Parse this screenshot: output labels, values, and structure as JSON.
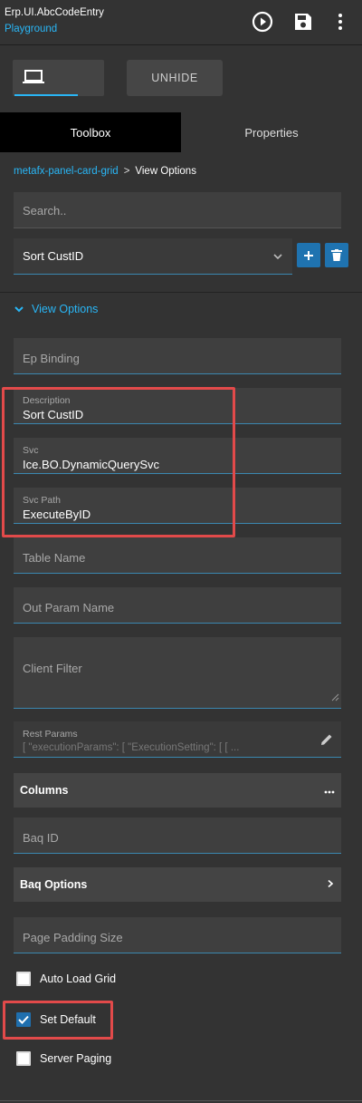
{
  "header": {
    "title": "Erp.UI.AbcCodeEntry",
    "subtitle": "Playground",
    "icons": [
      "play-icon",
      "save-icon",
      "more-vertical-icon"
    ]
  },
  "device": {
    "icon": "laptop-icon",
    "unhide_label": "UNHIDE"
  },
  "tabs": [
    {
      "label": "Toolbox",
      "active": true
    },
    {
      "label": "Properties",
      "active": false
    }
  ],
  "breadcrumb": {
    "link": "metafx-panel-card-grid",
    "separator": ">",
    "current": "View Options"
  },
  "search": {
    "placeholder": "Search.."
  },
  "sort_select": {
    "value": "Sort CustID"
  },
  "section": {
    "label": "View Options"
  },
  "fields": {
    "ep_binding": {
      "placeholder": "Ep Binding"
    },
    "description": {
      "label": "Description",
      "value": "Sort CustID"
    },
    "svc": {
      "label": "Svc",
      "value": "Ice.BO.DynamicQuerySvc"
    },
    "svc_path": {
      "label": "Svc Path",
      "value": "ExecuteByID"
    },
    "table_name": {
      "placeholder": "Table Name"
    },
    "out_param_name": {
      "placeholder": "Out Param Name"
    },
    "client_filter": {
      "placeholder": "Client Filter"
    },
    "rest_params": {
      "label": "Rest Params",
      "value": "[ \"executionParams\": [   \"ExecutionSetting\": [     [      ..."
    },
    "baq_id": {
      "placeholder": "Baq ID"
    },
    "page_padding_size": {
      "placeholder": "Page Padding Size"
    }
  },
  "bars": {
    "columns": {
      "label": "Columns"
    },
    "baq_options": {
      "label": "Baq Options"
    }
  },
  "checkboxes": [
    {
      "label": "Auto Load Grid",
      "checked": false
    },
    {
      "label": "Set Default",
      "checked": true
    },
    {
      "label": "Server Paging",
      "checked": false
    }
  ],
  "colors": {
    "accent": "#29b6f6",
    "highlight": "#e24a4a",
    "button": "#1f73b0",
    "background": "#333333"
  }
}
